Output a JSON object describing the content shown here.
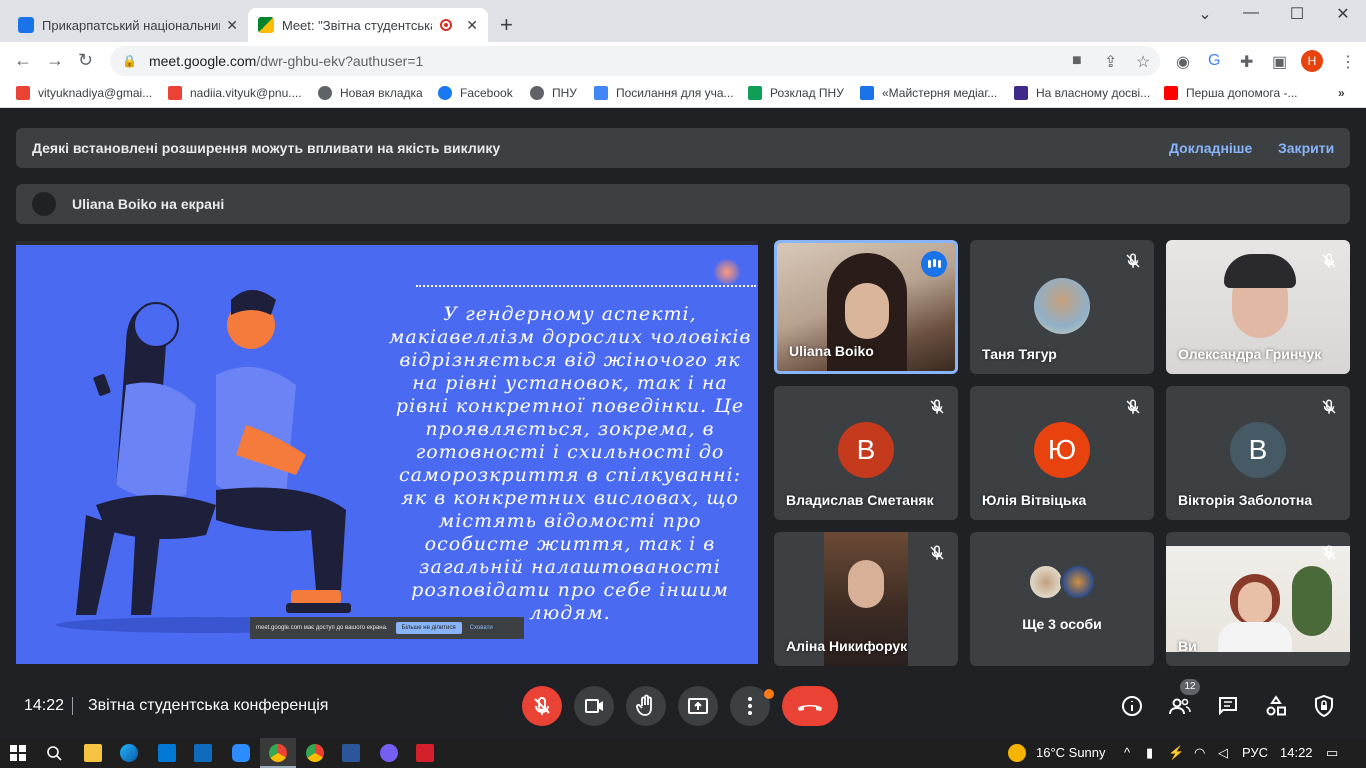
{
  "browser": {
    "tabs": [
      {
        "title": "Прикарпатський національний",
        "favicon_color": "#1a73e8"
      },
      {
        "title": "Meet: \"Звітна студентська к",
        "favicon_color": "#00832d"
      }
    ],
    "new_tab": "+",
    "window_controls": {
      "minimize": "—",
      "maximize": "☐",
      "close": "✕",
      "tabsearch": "⌄"
    },
    "url_host": "meet.google.com",
    "url_rest": "/dwr-ghbu-ekv?authuser=1",
    "profile_letter": "H",
    "bookmarks": [
      {
        "label": "vityuknadiya@gmai...",
        "color": "#ea4335"
      },
      {
        "label": "nadiia.vityuk@pnu....",
        "color": "#ea4335"
      },
      {
        "label": "Новая вкладка",
        "color": "#5f6368"
      },
      {
        "label": "Facebook",
        "color": "#1877f2"
      },
      {
        "label": "ПНУ",
        "color": "#5f6368"
      },
      {
        "label": "Посилання для уча...",
        "color": "#4285f4"
      },
      {
        "label": "Розклад ПНУ",
        "color": "#0f9d58"
      },
      {
        "label": "«Майстерня медіаг...",
        "color": "#1a73e8"
      },
      {
        "label": "На власному досві...",
        "color": "#3f2a8c"
      },
      {
        "label": "Перша допомога -...",
        "color": "#ff0000"
      }
    ],
    "bookmarks_more": "»"
  },
  "meet": {
    "banner_text": "Деякі встановлені розширення можуть впливати на якість виклику",
    "banner_more": "Докладніше",
    "banner_close": "Закрити",
    "presenting_text": "Uliana Boiko на екрані",
    "slide_text": "У гендерному аспекті, макіавеллізм дорослих чоловіків відрізняється від жіночого як на рівні установок, так і на рівні конкретної поведінки. Це проявляється, зокрема, в готовності і схильності до саморозкриття в спілкуванні: як в конкретних висловах, що містять відомості про особисте життя, так і в загальній налаштованості розповідати про себе іншим людям.",
    "sharebar": {
      "msg": "meet.google.com має доступ до вашого екрана.",
      "stop": "Більше не ділитися",
      "hide": "Сховати"
    },
    "participants": [
      {
        "name": "Uliana Boiko"
      },
      {
        "name": "Таня Тягур"
      },
      {
        "name": "Олександра Гринчук"
      },
      {
        "name": "Владислав Сметаняк",
        "letter": "В",
        "color": "#c5391c"
      },
      {
        "name": "Юлія Вітвіцька",
        "letter": "Ю",
        "color": "#e8430f"
      },
      {
        "name": "Вікторія Заболотна",
        "letter": "В",
        "color": "#455a64"
      },
      {
        "name": "Аліна Никифорук"
      },
      {
        "name": "Ще 3 особи"
      },
      {
        "name": "Ви"
      }
    ],
    "time": "14:22",
    "meeting_title": "Звітна студентська конференція",
    "participant_count": "12"
  },
  "taskbar": {
    "weather": "16°C  Sunny",
    "lang": "РУС",
    "time": "14:22"
  }
}
